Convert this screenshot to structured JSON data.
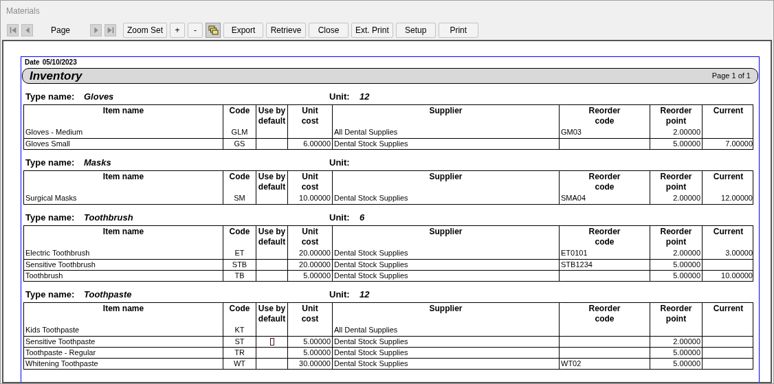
{
  "window": {
    "title": "Materials"
  },
  "toolbar": {
    "nav_buttons": [
      {
        "kind": "first",
        "disabled": true
      },
      {
        "kind": "prev",
        "disabled": true
      },
      {
        "kind": "next",
        "disabled": true
      },
      {
        "kind": "last",
        "disabled": true
      }
    ],
    "page_label": "Page",
    "buttons": [
      {
        "kind": "text",
        "label": "Zoom Set"
      },
      {
        "kind": "text",
        "label": "+"
      },
      {
        "kind": "text",
        "label": "-"
      },
      {
        "kind": "icon",
        "pressed": true
      },
      {
        "kind": "text",
        "label": "Export"
      },
      {
        "kind": "text",
        "label": "Retrieve"
      },
      {
        "kind": "text",
        "label": "Close"
      },
      {
        "kind": "text",
        "label": "Ext. Print"
      },
      {
        "kind": "text",
        "label": "Setup"
      },
      {
        "kind": "text",
        "label": "Print"
      }
    ]
  },
  "report": {
    "date_label": "Date",
    "date": "05/10/2023",
    "title": "Inventory",
    "page_info": "Page 1 of 1",
    "groups": [
      {
        "type_label": "Type name:",
        "type_name": "Gloves",
        "unit_label": "Unit:",
        "unit": "12",
        "columns": [
          "Item name",
          "Code",
          "Use by default",
          "Unit cost",
          "Supplier",
          "Reorder code",
          "Reorder point",
          "Current"
        ],
        "rows": [
          {
            "item": "Gloves - Medium",
            "code": "GLM",
            "use_by_default_box": false,
            "unit_cost": "",
            "supplier": "All Dental Supplies",
            "reorder_code": "GM03",
            "reorder_point": "2.00000",
            "current": ""
          },
          {
            "item": "Gloves Small",
            "code": "GS",
            "use_by_default_box": false,
            "unit_cost": "6.00000",
            "supplier": "Dental Stock Supplies",
            "reorder_code": "",
            "reorder_point": "5.00000",
            "current": "7.00000"
          }
        ]
      },
      {
        "type_label": "Type name:",
        "type_name": "Masks",
        "unit_label": "Unit:",
        "columns": [
          "Item name",
          "Code",
          "Use by default",
          "Unit cost",
          "Supplier",
          "Reorder code",
          "Reorder point",
          "Current"
        ],
        "rows": [
          {
            "item": "Surgical Masks",
            "code": "SM",
            "use_by_default_box": false,
            "unit_cost": "10.00000",
            "supplier": "Dental Stock Supplies",
            "reorder_code": "SMA04",
            "reorder_point": "2.00000",
            "current": "12.00000"
          }
        ]
      },
      {
        "type_label": "Type name:",
        "type_name": "Toothbrush",
        "unit_label": "Unit:",
        "unit": "6",
        "columns": [
          "Item name",
          "Code",
          "Use by default",
          "Unit cost",
          "Supplier",
          "Reorder code",
          "Reorder point",
          "Current"
        ],
        "rows": [
          {
            "item": "Electric Toothbrush",
            "code": "ET",
            "use_by_default_box": false,
            "unit_cost": "20.00000",
            "supplier": "Dental Stock Supplies",
            "reorder_code": "ET0101",
            "reorder_point": "2.00000",
            "current": "3.00000"
          },
          {
            "item": "Sensitive Toothbrush",
            "code": "STB",
            "use_by_default_box": false,
            "unit_cost": "20.00000",
            "supplier": "Dental Stock Supplies",
            "reorder_code": "STB1234",
            "reorder_point": "5.00000",
            "current": ""
          },
          {
            "item": "Toothbrush",
            "code": "TB",
            "use_by_default_box": false,
            "unit_cost": "5.00000",
            "supplier": "Dental Stock Supplies",
            "reorder_code": "",
            "reorder_point": "5.00000",
            "current": "10.00000"
          }
        ]
      },
      {
        "type_label": "Type name:",
        "type_name": "Toothpaste",
        "unit_label": "Unit:",
        "unit": "12",
        "columns": [
          "Item name",
          "Code",
          "Use by default",
          "Unit cost",
          "Supplier",
          "Reorder code",
          "Reorder point",
          "Current"
        ],
        "rows": [
          {
            "item": "Kids Toothpaste",
            "code": "KT",
            "use_by_default_box": false,
            "unit_cost": "",
            "supplier": "All Dental Supplies",
            "reorder_code": "",
            "reorder_point": "",
            "current": ""
          },
          {
            "item": "Sensitive Toothpaste",
            "code": "ST",
            "use_by_default_box": true,
            "unit_cost": "5.00000",
            "supplier": "Dental Stock Supplies",
            "reorder_code": "",
            "reorder_point": "2.00000",
            "current": ""
          },
          {
            "item": "Toothpaste - Regular",
            "code": "TR",
            "use_by_default_box": false,
            "unit_cost": "5.00000",
            "supplier": "Dental Stock Supplies",
            "reorder_code": "",
            "reorder_point": "5.00000",
            "current": ""
          },
          {
            "item": "Whitening Toothpaste",
            "code": "WT",
            "use_by_default_box": false,
            "unit_cost": "30.00000",
            "supplier": "Dental Stock Supplies",
            "reorder_code": "WT02",
            "reorder_point": "5.00000",
            "current": ""
          }
        ]
      }
    ]
  }
}
